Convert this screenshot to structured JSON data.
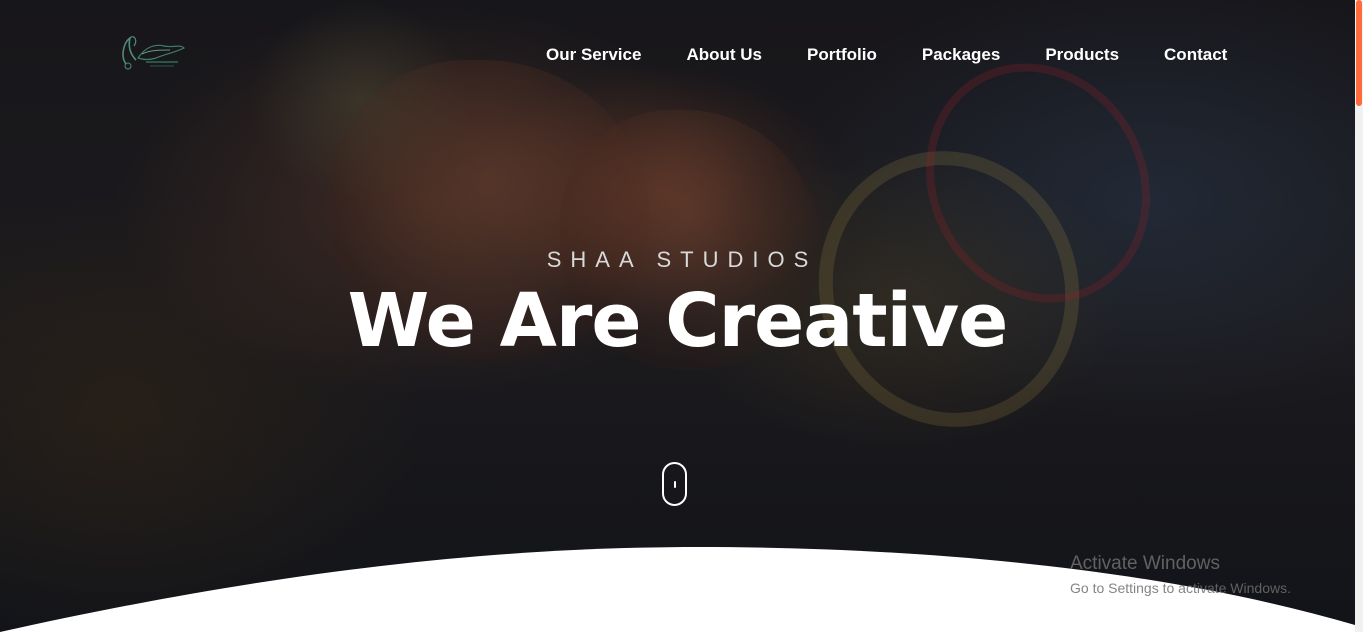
{
  "brand": {
    "logo_alt": "Shaa Studios",
    "logo_icon": "calligraphy-logo",
    "accent_color": "#ff6b3d"
  },
  "nav": {
    "items": [
      {
        "label": "Our Service"
      },
      {
        "label": "About Us"
      },
      {
        "label": "Portfolio"
      },
      {
        "label": "Packages"
      },
      {
        "label": "Products"
      },
      {
        "label": "Contact"
      }
    ]
  },
  "hero": {
    "subtitle": "SHAA STUDIOS",
    "headline": "We Are Creative",
    "scroll_icon": "mouse-scroll-icon"
  },
  "windows_watermark": {
    "title": "Activate Windows",
    "subtitle": "Go to Settings to activate Windows."
  }
}
